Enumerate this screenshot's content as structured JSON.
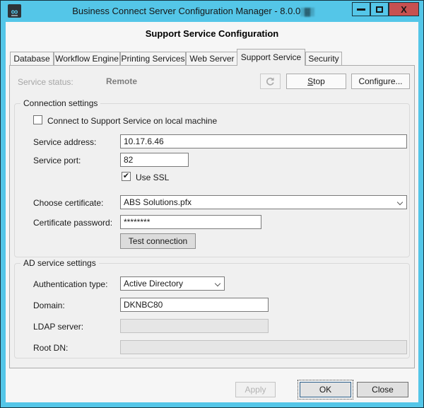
{
  "window": {
    "title": "Business Connect Server Configuration Manager - 8.0.0",
    "version_scramble": "▒▓▒",
    "heading": "Support Service Configuration"
  },
  "icons": {
    "app": "∞",
    "close": "X",
    "checkmark": "✔"
  },
  "colors": {
    "titlebar": "#54C6E8",
    "close_button": "#C75050",
    "content_bg": "#F0F0F0",
    "disabled_text": "#A6A6A6"
  },
  "tabs": [
    {
      "label": "Database",
      "active": false
    },
    {
      "label": "Workflow Engine",
      "active": false
    },
    {
      "label": "Printing Services",
      "active": false
    },
    {
      "label": "Web Server",
      "active": false
    },
    {
      "label": "Support Service",
      "active": true
    },
    {
      "label": "Security",
      "active": false
    }
  ],
  "status": {
    "label": "Service status:",
    "value": "Remote",
    "stop_button": "Stop",
    "configure_button": "Configure..."
  },
  "connection": {
    "legend": "Connection settings",
    "local_machine": {
      "label": "Connect to Support Service on local machine",
      "checked": false
    },
    "service_address": {
      "label": "Service address:",
      "value": "10.17.6.46"
    },
    "service_port": {
      "label": "Service port:",
      "value": "82"
    },
    "use_ssl": {
      "label": "Use SSL",
      "checked": true
    },
    "certificate": {
      "label": "Choose certificate:",
      "value": "ABS Solutions.pfx"
    },
    "certificate_password": {
      "label": "Certificate password:",
      "value": "********"
    },
    "test_button": "Test connection"
  },
  "ad": {
    "legend": "AD service settings",
    "auth_type": {
      "label": "Authentication type:",
      "value": "Active Directory"
    },
    "domain": {
      "label": "Domain:",
      "value": "DKNBC80"
    },
    "ldap_server": {
      "label": "LDAP server:",
      "value": ""
    },
    "root_dn": {
      "label": "Root DN:",
      "value": ""
    }
  },
  "footer": {
    "apply_button": "Apply",
    "ok_button": "OK",
    "close_button": "Close"
  }
}
